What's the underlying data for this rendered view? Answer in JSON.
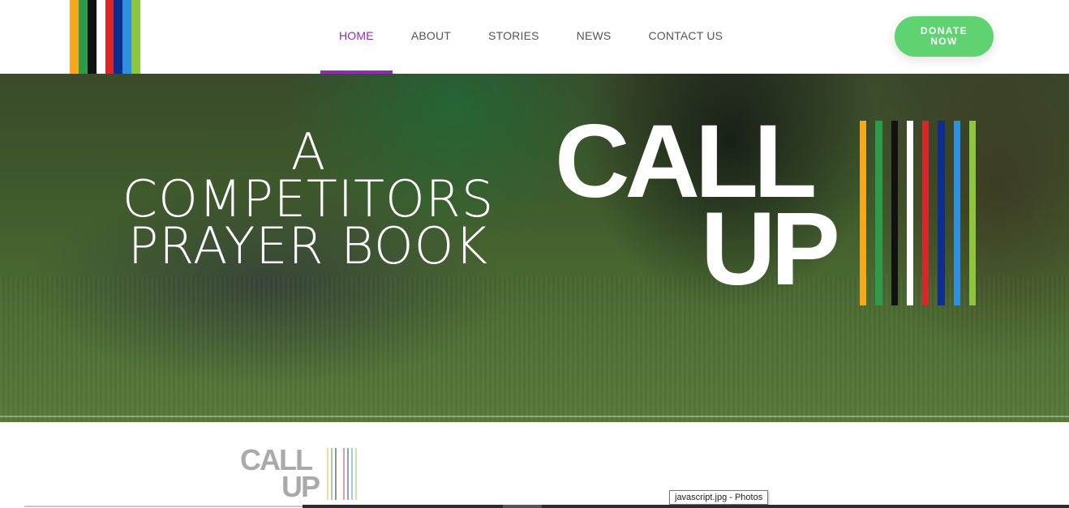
{
  "brand": {
    "stripe_colors": [
      "#f5a81c",
      "#2e9b4a",
      "#111111",
      "#ffffff",
      "#d8262b",
      "#0d2d8f",
      "#2f8fe0",
      "#8cc63f"
    ]
  },
  "nav": {
    "items": [
      {
        "label": "HOME",
        "active": true
      },
      {
        "label": "ABOUT",
        "active": false
      },
      {
        "label": "STORIES",
        "active": false
      },
      {
        "label": "NEWS",
        "active": false
      },
      {
        "label": "CONTACT US",
        "active": false
      }
    ],
    "active_color": "#8e2bb8"
  },
  "donate": {
    "line1": "DONATE",
    "line2": "NOW",
    "color": "#5fd272"
  },
  "hero": {
    "title_line1": "A",
    "title_line2": "COMPETITORS",
    "title_line3": "PRAYER BOOK",
    "logo_call": "CALL",
    "logo_up": "UP"
  },
  "lower": {
    "logo_call": "CALL",
    "logo_up": "UP",
    "tooltip": "javascript.jpg - Photos"
  }
}
